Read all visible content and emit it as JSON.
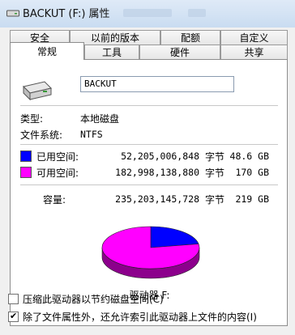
{
  "window": {
    "title": "BACKUT (F:) 属性"
  },
  "tabs": {
    "row1": [
      "安全",
      "以前的版本",
      "配额",
      "自定义"
    ],
    "row2": [
      "常规",
      "工具",
      "硬件",
      "共享"
    ],
    "active": "常规"
  },
  "general": {
    "drive_name": "BACKUT",
    "type_label": "类型:",
    "type_value": "本地磁盘",
    "fs_label": "文件系统:",
    "fs_value": "NTFS",
    "used": {
      "label": "已用空间:",
      "bytes": "52,205,006,848",
      "unit": "字节",
      "size": "48.6 GB",
      "color": "#0000ff"
    },
    "free": {
      "label": "可用空间:",
      "bytes": "182,998,138,880",
      "unit": "字节",
      "size": "170 GB",
      "color": "#ff00ff"
    },
    "capacity": {
      "label": "容量:",
      "bytes": "235,203,145,728",
      "unit": "字节",
      "size": "219 GB"
    },
    "drive_caption": "驱动器 F:",
    "compress_label": "压缩此驱动器以节约磁盘空间(C)",
    "compress_checked": false,
    "index_label": "除了文件属性外，还允许索引此驱动器上文件的内容(I)",
    "index_checked": true
  },
  "chart_data": {
    "type": "pie",
    "labels": [
      "已用空间",
      "可用空间"
    ],
    "values": [
      52205006848,
      182998138880
    ],
    "colors": [
      "#0000ff",
      "#ff00ff"
    ]
  }
}
